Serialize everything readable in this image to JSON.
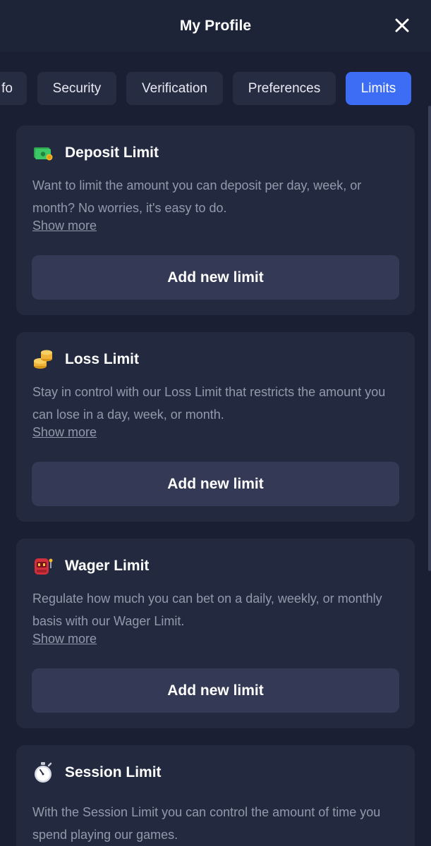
{
  "header": {
    "title": "My Profile",
    "close_icon": "close-icon"
  },
  "tabs": [
    {
      "label": "Info",
      "visible_text": "fo",
      "active": false
    },
    {
      "label": "Security",
      "active": false
    },
    {
      "label": "Verification",
      "active": false
    },
    {
      "label": "Preferences",
      "active": false
    },
    {
      "label": "Limits",
      "active": true
    }
  ],
  "limits": [
    {
      "icon": "money-icon",
      "title": "Deposit Limit",
      "description": "Want to limit the amount you can deposit per day, week, or month? No worries, it's easy to do.",
      "show_more": "Show more",
      "button": "Add new limit"
    },
    {
      "icon": "coins-icon",
      "title": "Loss Limit",
      "description": "Stay in control with our Loss Limit that restricts the amount you can lose in a day, week, or month.",
      "show_more": "Show more",
      "button": "Add new limit"
    },
    {
      "icon": "slot-machine-icon",
      "title": "Wager Limit",
      "description": "Regulate how much you can bet on a daily, weekly, or monthly basis with our Wager Limit.",
      "show_more": "Show more",
      "button": "Add new limit"
    },
    {
      "icon": "stopwatch-icon",
      "title": "Session Limit",
      "description": "With the Session Limit you can control the amount of time you spend playing our games."
    }
  ],
  "colors": {
    "background": "#1a1f33",
    "header": "#1e2438",
    "card": "#232a40",
    "button": "#343a55",
    "tab": "#262c42",
    "tab_active": "#3d6cf5",
    "muted_text": "#9399ad"
  }
}
